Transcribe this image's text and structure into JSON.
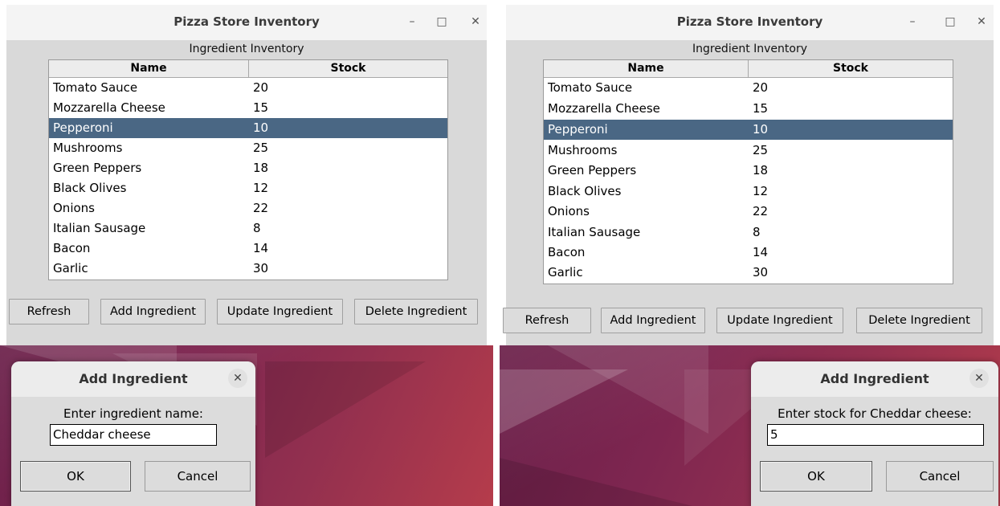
{
  "window_title": "Pizza Store Inventory",
  "window_controls": {
    "minimize": "–",
    "maximize": "□",
    "close": "✕"
  },
  "section_title": "Ingredient Inventory",
  "columns": {
    "name": "Name",
    "stock": "Stock"
  },
  "rows": [
    {
      "name": "Tomato Sauce",
      "stock": "20"
    },
    {
      "name": "Mozzarella Cheese",
      "stock": "15"
    },
    {
      "name": "Pepperoni",
      "stock": "10"
    },
    {
      "name": "Mushrooms",
      "stock": "25"
    },
    {
      "name": "Green Peppers",
      "stock": "18"
    },
    {
      "name": "Black Olives",
      "stock": "12"
    },
    {
      "name": "Onions",
      "stock": "22"
    },
    {
      "name": "Italian Sausage",
      "stock": "8"
    },
    {
      "name": "Bacon",
      "stock": "14"
    },
    {
      "name": "Garlic",
      "stock": "30"
    }
  ],
  "selected_row": "Pepperoni",
  "buttons": {
    "refresh": "Refresh",
    "add": "Add Ingredient",
    "update": "Update Ingredient",
    "delete": "Delete Ingredient"
  },
  "dialog_left": {
    "title": "Add Ingredient",
    "close": "✕",
    "prompt": "Enter ingredient name:",
    "value": "Cheddar cheese",
    "ok": "OK",
    "cancel": "Cancel"
  },
  "dialog_right": {
    "title": "Add Ingredient",
    "close": "✕",
    "prompt": "Enter stock for Cheddar cheese:",
    "value": "5",
    "ok": "OK",
    "cancel": "Cancel"
  },
  "colors": {
    "selection": "#4a6784",
    "window_bg": "#d9d9d9",
    "desktop": "#8a2a50"
  }
}
